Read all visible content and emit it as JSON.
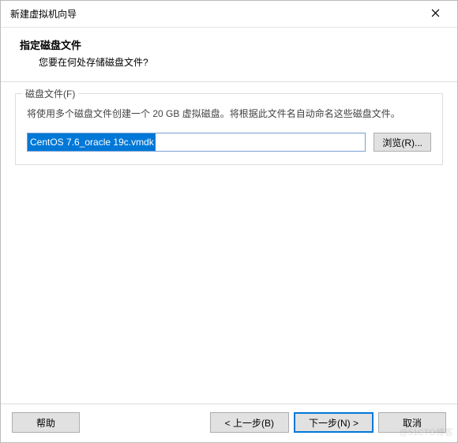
{
  "window": {
    "title": "新建虚拟机向导"
  },
  "header": {
    "title": "指定磁盘文件",
    "subtitle": "您要在何处存储磁盘文件?"
  },
  "disk": {
    "legend": "磁盘文件(F)",
    "description": "将使用多个磁盘文件创建一个 20 GB 虚拟磁盘。将根据此文件名自动命名这些磁盘文件。",
    "filename": "CentOS 7.6_oracle 19c.vmdk",
    "browse_label": "浏览(R)..."
  },
  "footer": {
    "help": "帮助",
    "back": "< 上一步(B)",
    "next": "下一步(N) >",
    "cancel": "取消"
  },
  "watermark": "@51CTO博客"
}
